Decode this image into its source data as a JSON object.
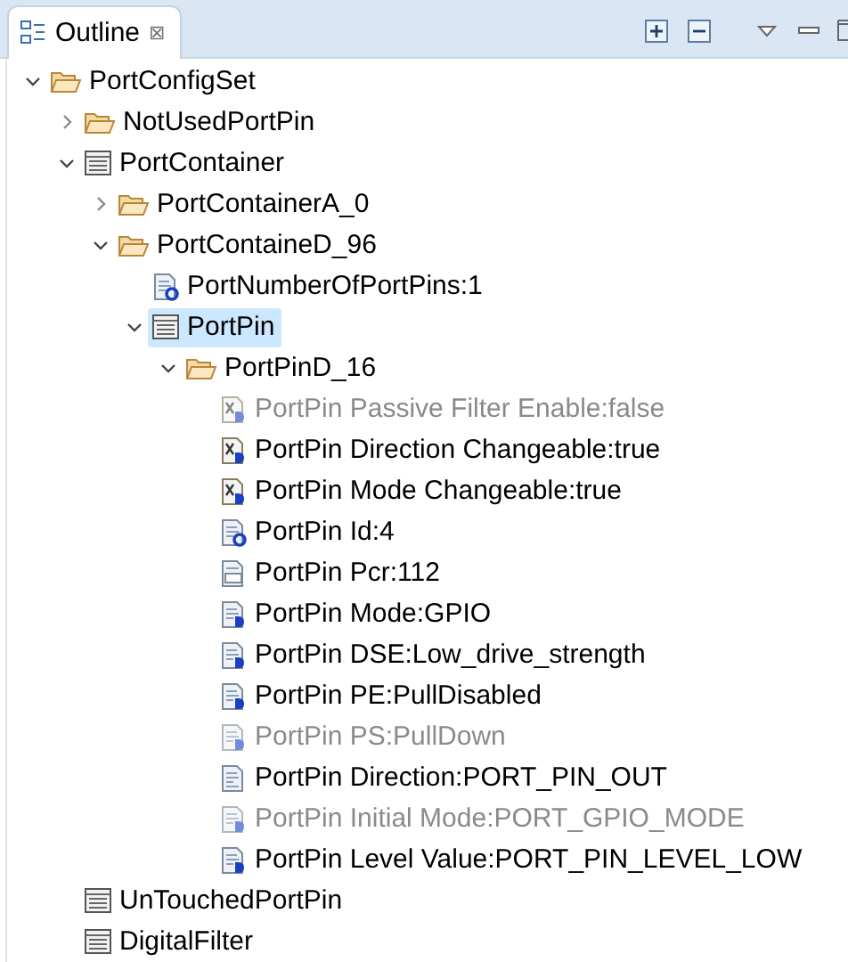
{
  "view_tab": {
    "title": "Outline",
    "close": "⊠"
  },
  "tree": [
    {
      "label": "PortConfigSet",
      "kind": "folder",
      "expanded": true,
      "selected": false,
      "dimmed": false,
      "children": [
        {
          "label": "NotUsedPortPin",
          "kind": "folder",
          "expanded": false,
          "selected": false,
          "dimmed": false
        },
        {
          "label": "PortContainer",
          "kind": "table",
          "expanded": true,
          "selected": false,
          "dimmed": false,
          "children": [
            {
              "label": "PortContainerA_0",
              "kind": "folder",
              "expanded": false,
              "selected": false,
              "dimmed": false
            },
            {
              "label": "PortContaineD_96",
              "kind": "folder",
              "expanded": true,
              "selected": false,
              "dimmed": false,
              "children": [
                {
                  "label": "PortNumberOfPortPins:1",
                  "kind": "calc",
                  "selected": false,
                  "dimmed": false
                },
                {
                  "label": "PortPin",
                  "kind": "table",
                  "expanded": true,
                  "selected": true,
                  "dimmed": false,
                  "children": [
                    {
                      "label": "PortPinD_16",
                      "kind": "folder",
                      "expanded": true,
                      "selected": false,
                      "dimmed": false,
                      "children": [
                        {
                          "label": "PortPin Passive Filter Enable:false",
                          "kind": "boolean",
                          "selected": false,
                          "dimmed": true
                        },
                        {
                          "label": "PortPin Direction Changeable:true",
                          "kind": "boolean",
                          "selected": false,
                          "dimmed": false
                        },
                        {
                          "label": "PortPin Mode Changeable:true",
                          "kind": "boolean",
                          "selected": false,
                          "dimmed": false
                        },
                        {
                          "label": "PortPin Id:4",
                          "kind": "calc",
                          "selected": false,
                          "dimmed": false
                        },
                        {
                          "label": "PortPin Pcr:112",
                          "kind": "integer",
                          "selected": false,
                          "dimmed": false
                        },
                        {
                          "label": "PortPin Mode:GPIO",
                          "kind": "enum",
                          "selected": false,
                          "dimmed": false
                        },
                        {
                          "label": "PortPin DSE:Low_drive_strength",
                          "kind": "enum",
                          "selected": false,
                          "dimmed": false
                        },
                        {
                          "label": "PortPin PE:PullDisabled",
                          "kind": "enum",
                          "selected": false,
                          "dimmed": false
                        },
                        {
                          "label": "PortPin PS:PullDown",
                          "kind": "enum",
                          "selected": false,
                          "dimmed": true
                        },
                        {
                          "label": "PortPin Direction:PORT_PIN_OUT",
                          "kind": "document",
                          "selected": false,
                          "dimmed": false
                        },
                        {
                          "label": "PortPin Initial Mode:PORT_GPIO_MODE",
                          "kind": "enum",
                          "selected": false,
                          "dimmed": true
                        },
                        {
                          "label": "PortPin Level Value:PORT_PIN_LEVEL_LOW",
                          "kind": "enum",
                          "selected": false,
                          "dimmed": false
                        }
                      ]
                    }
                  ]
                }
              ]
            }
          ]
        },
        {
          "label": "UnTouchedPortPin",
          "kind": "table",
          "selected": false,
          "dimmed": false
        },
        {
          "label": "DigitalFilter",
          "kind": "table",
          "selected": false,
          "dimmed": false
        }
      ]
    }
  ]
}
